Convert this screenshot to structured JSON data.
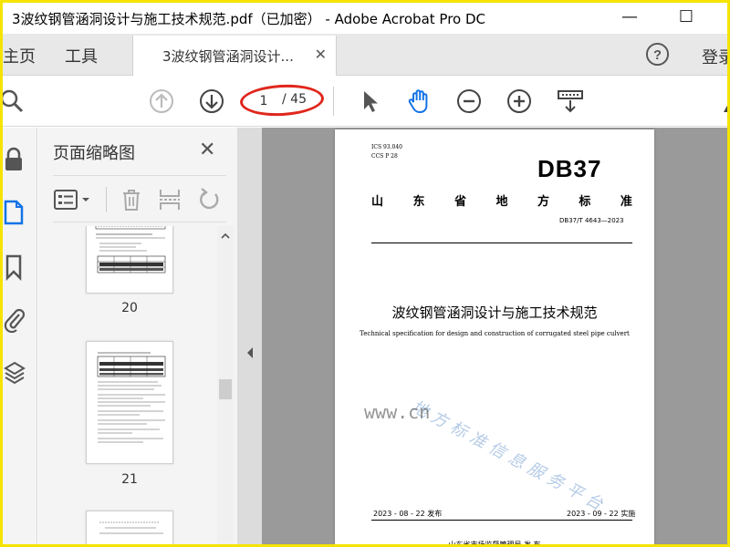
{
  "window": {
    "title": "3波纹钢管涵洞设计与施工技术规范.pdf（已加密） - Adobe Acrobat Pro DC"
  },
  "tabs": {
    "home": "主页",
    "tools": "工具",
    "doc_tab": "3波纹钢管涵洞设计...",
    "login": "登录"
  },
  "toolbar": {
    "current_page": "1",
    "total_pages": "/ 45"
  },
  "thumbnails": {
    "title": "页面缩略图",
    "pages": [
      "20",
      "21"
    ]
  },
  "document": {
    "ics": "ICS  93.040",
    "ccs": "CCS  P 28",
    "logo": "DB37",
    "standard_chars": [
      "山",
      "东",
      "省",
      "地",
      "方",
      "标",
      "准"
    ],
    "code": "DB37/T 4643—2023",
    "title": "波纹钢管涵洞设计与施工技术规范",
    "subtitle": "Technical specification for design and construction of corrugated steel pipe culvert",
    "watermark": "地方标准信息服务平台",
    "issue_date": "2023 - 08 - 22 发布",
    "implement_date": "2023 - 09 - 22 实施",
    "publisher": "山东省市场监督管理局    发 布"
  },
  "overlay": {
    "site_watermark": "www.cn"
  },
  "colors": {
    "frame_border": "#f5e400",
    "annotation_red": "#e0261c",
    "accent_blue": "#1473e6"
  }
}
